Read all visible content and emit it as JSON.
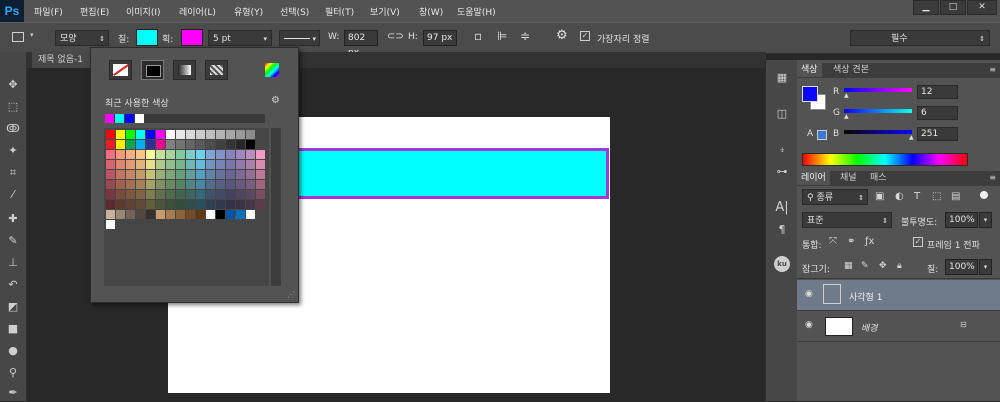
{
  "app": {
    "logo": "Ps"
  },
  "menu": [
    "파일(F)",
    "편집(E)",
    "이미지(I)",
    "레이어(L)",
    "유형(Y)",
    "선택(S)",
    "필터(T)",
    "보기(V)",
    "창(W)",
    "도움말(H)"
  ],
  "window_controls": [
    "▁",
    "□",
    "✕"
  ],
  "options": {
    "mode": "모양",
    "fill_label": "칠:",
    "stroke_label": "획:",
    "fill_color": "#00ffff",
    "stroke_color": "#ff00ff",
    "stroke_width": "5 pt",
    "w_label": "W:",
    "w_value": "802 px",
    "h_label": "H:",
    "h_value": "97 px",
    "align_edges_label": "가장자리 정렬",
    "workspace": "필수"
  },
  "document": {
    "tab_title": "제목 없음-1"
  },
  "swatch_popup": {
    "recent_label": "최근 사용한 색상",
    "recent_colors": [
      "#ff00ff",
      "#00ffff",
      "#0000ff",
      "#ffffff"
    ]
  },
  "color_panel": {
    "tabs": [
      "색상",
      "색상 견본"
    ],
    "r_label": "R",
    "g_label": "G",
    "b_label": "B",
    "r": "12",
    "g": "6",
    "b": "251",
    "foreground": "#0c06fb",
    "background": "#ffffff"
  },
  "layers_panel": {
    "tabs": [
      "레이어",
      "채널",
      "패스"
    ],
    "filter": "종류",
    "blend_mode": "표준",
    "opacity_label": "불투명도:",
    "opacity": "100%",
    "unify_label": "통합:",
    "propagate_label": "프레임 1 전파",
    "lock_label": "잠그기:",
    "fill_label": "칠:",
    "fill": "100%",
    "layers": [
      {
        "name": "사각형 1",
        "selected": true
      },
      {
        "name": "배경",
        "selected": false
      }
    ]
  }
}
